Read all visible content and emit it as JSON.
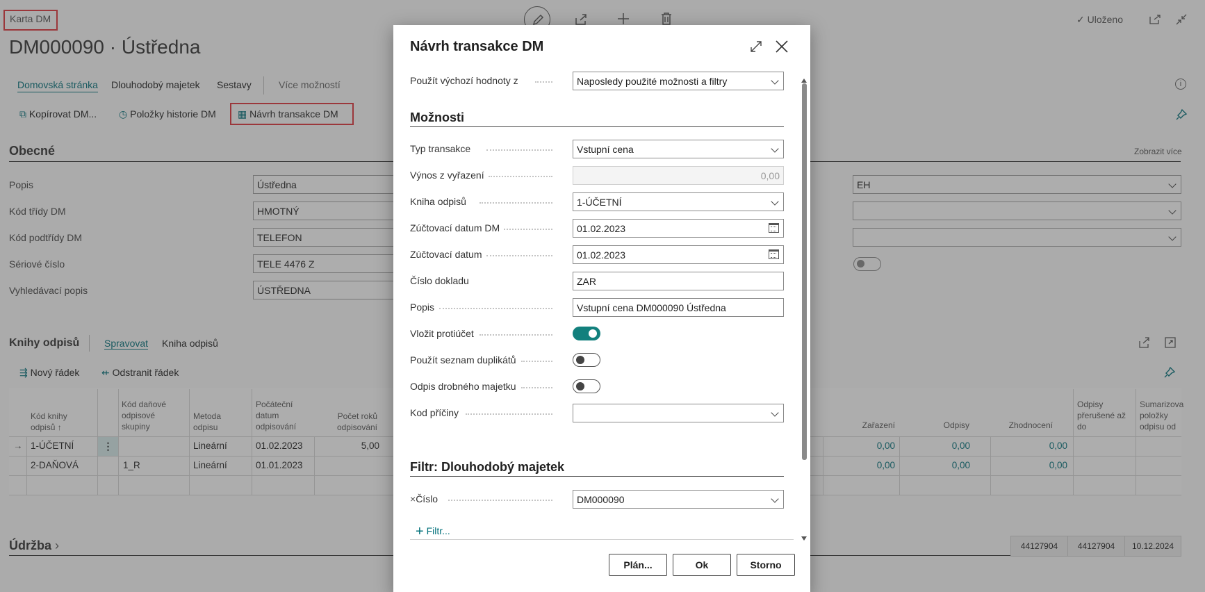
{
  "background": {
    "breadcrumb": "Karta DM",
    "page_title": "DM000090 · Ústředna",
    "saved_status": "Uloženo",
    "nav_tabs": [
      "Domovská stránka",
      "Dlouhodobý majetek",
      "Sestavy",
      "Více možností"
    ],
    "actions": [
      "Kopírovat DM...",
      "Položky historie DM",
      "Návrh transakce DM"
    ],
    "general_section": "Obecné",
    "show_more": "Zobrazit více",
    "fields": [
      {
        "label": "Popis",
        "value": "Ústředna"
      },
      {
        "label": "Kód třídy DM",
        "value": "HMOTNÝ"
      },
      {
        "label": "Kód podtřídy DM",
        "value": "TELEFON"
      },
      {
        "label": "Sériové číslo",
        "value": "TELE 4476 Z"
      },
      {
        "label": "Vyhledávací popis",
        "value": "ÚSTŘEDNA"
      }
    ],
    "right_field_value": "EH",
    "books_section": "Knihy odpisů",
    "books_tabs": [
      "Spravovat",
      "Kniha odpisů"
    ],
    "books_actions": [
      "Nový řádek",
      "Odstranit řádek"
    ],
    "grid_headers": {
      "col1": "Kód knihy odpisů ↑",
      "col2": "Kód daňové odpisové skupiny",
      "col3": "Metoda odpisu",
      "col4": "Počáteční datum odpisování",
      "col5": "Počet roků odpisování",
      "col6": "Zařazení",
      "col7": "Odpisy",
      "col8": "Zhodnocení",
      "col9": "Odpisy přerušené až do",
      "col10": "Sumarizova položky odpisu od"
    },
    "grid_rows": [
      {
        "code": "1-ÚČETNÍ",
        "group": "",
        "method": "Lineární",
        "start": "01.02.2023",
        "years": "5,00",
        "zarazeni": "0,00",
        "odpisy": "0,00",
        "zhodnoceni": "0,00"
      },
      {
        "code": "2-DAŇOVÁ",
        "group": "1_R",
        "method": "Lineární",
        "start": "01.01.2023",
        "years": "",
        "zarazeni": "0,00",
        "odpisy": "0,00",
        "zhodnoceni": "0,00"
      }
    ],
    "maintenance_section": "Údržba",
    "footer_cells": [
      "44127904",
      "44127904",
      "10.12.2024"
    ]
  },
  "dialog": {
    "title": "Návrh transakce DM",
    "defaults_label": "Použít výchozí hodnoty z",
    "defaults_value": "Naposledy použité možnosti a filtry",
    "options_section": "Možnosti",
    "fields": {
      "typ_transakce": {
        "label": "Typ transakce",
        "value": "Vstupní cena"
      },
      "vynos": {
        "label": "Výnos z vyřazení",
        "value": "0,00"
      },
      "kniha": {
        "label": "Kniha odpisů",
        "value": "1-ÚČETNÍ"
      },
      "datum_dm": {
        "label": "Zúčtovací datum DM",
        "value": "01.02.2023"
      },
      "datum": {
        "label": "Zúčtovací datum",
        "value": "01.02.2023"
      },
      "doklad": {
        "label": "Číslo dokladu",
        "value": "ZAR"
      },
      "popis": {
        "label": "Popis",
        "value": "Vstupní cena DM000090 Ústředna"
      },
      "protiucet": {
        "label": "Vložit protiúčet",
        "on": true
      },
      "duplikaty": {
        "label": "Použít seznam duplikátů",
        "on": false
      },
      "drobny": {
        "label": "Odpis drobného majetku",
        "on": false
      },
      "pricina": {
        "label": "Kod příčiny",
        "value": ""
      }
    },
    "filter_section": "Filtr: Dlouhodobý majetek",
    "filter_field": {
      "label": "Číslo",
      "value": "DM000090"
    },
    "add_filter": "Filtr...",
    "buttons": {
      "plan": "Plán...",
      "ok": "Ok",
      "cancel": "Storno"
    }
  },
  "colors": {
    "accent": "#00707a",
    "toggle_on": "#12807d",
    "highlight": "#e0353b"
  }
}
